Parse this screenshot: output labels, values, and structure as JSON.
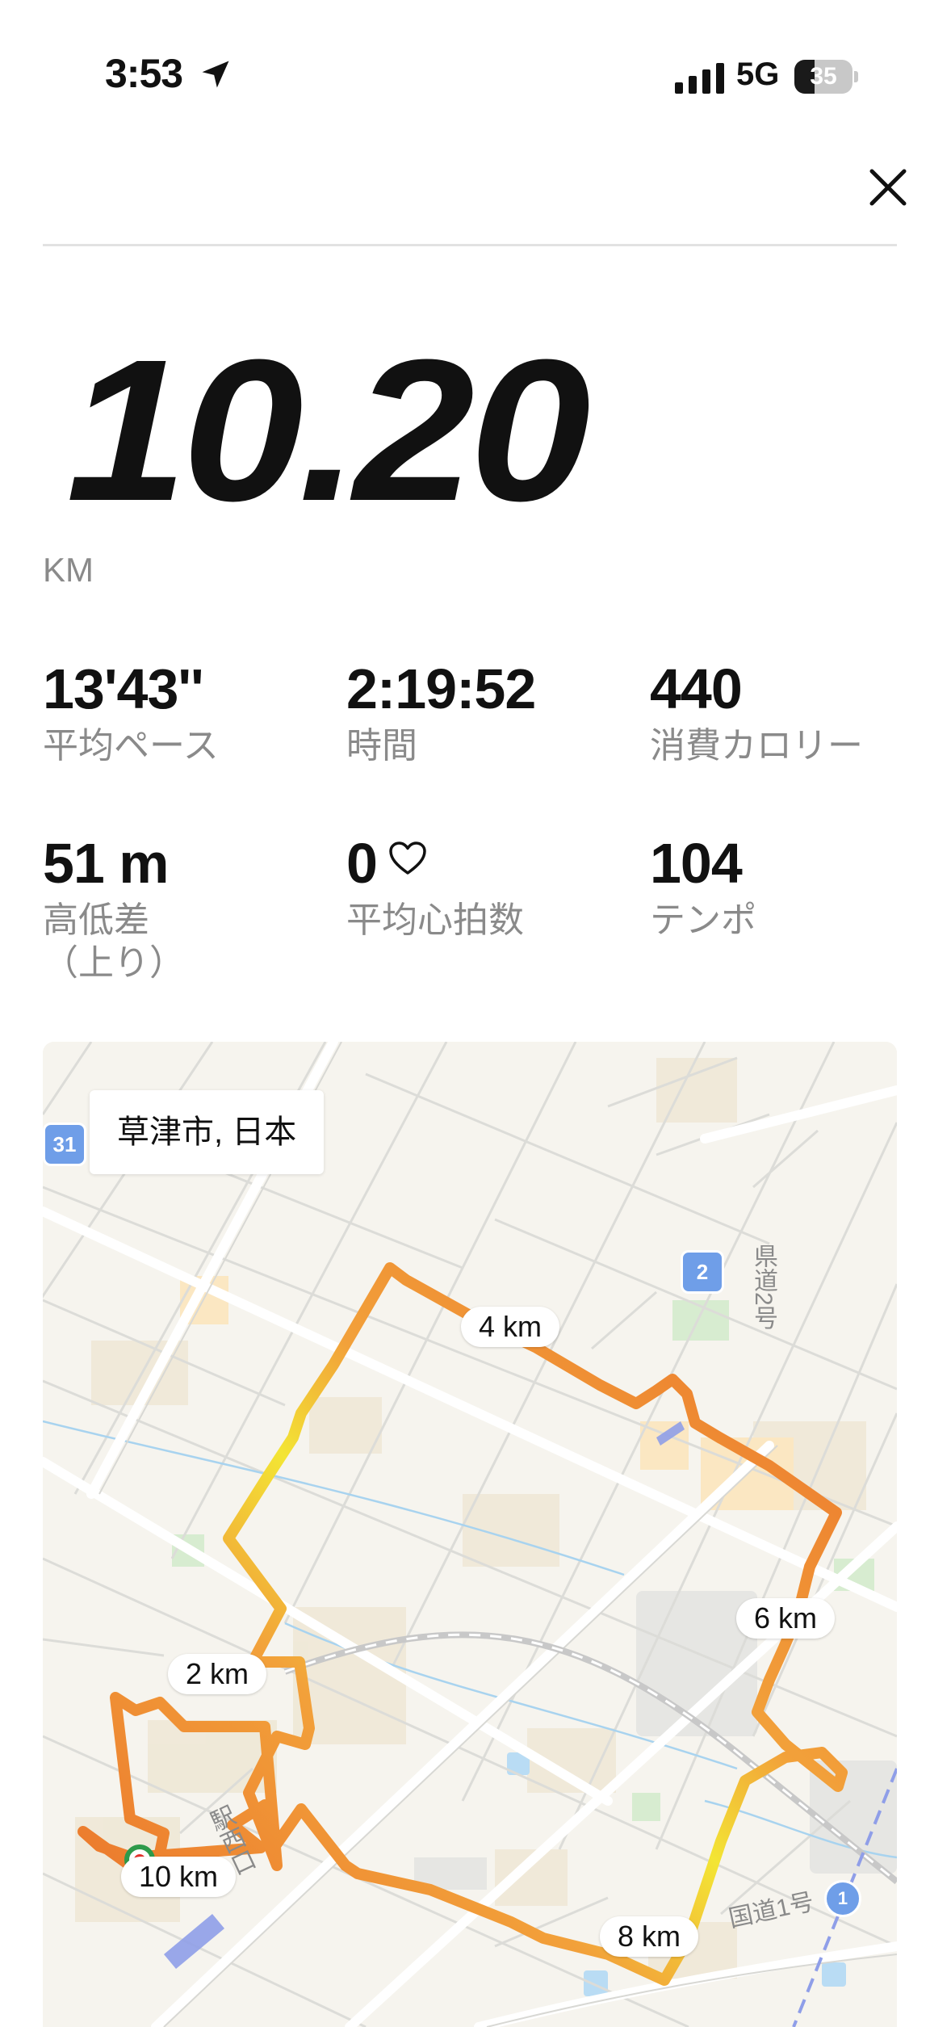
{
  "status_bar": {
    "time": "3:53",
    "network": "5G",
    "battery": 35
  },
  "run": {
    "distance": "10.20",
    "distance_unit": "KM"
  },
  "stats": [
    {
      "value": "13'43''",
      "label": "平均ペース"
    },
    {
      "value": "2:19:52",
      "label": "時間"
    },
    {
      "value": "440",
      "label": "消費カロリー"
    },
    {
      "value": "51 m",
      "label": "高低差\n（上り）"
    },
    {
      "value": "0",
      "label": "平均心拍数"
    },
    {
      "value": "104",
      "label": "テンポ"
    }
  ],
  "map": {
    "location": "草津市, 日本",
    "km_markers": [
      "2 km",
      "4 km",
      "6 km",
      "8 km",
      "10 km"
    ],
    "road_badges": [
      "31",
      "2",
      "1"
    ],
    "road_labels": [
      "県道2号",
      "国道1号",
      "駅西口"
    ]
  },
  "colors": {
    "route_start": "#f3e534",
    "route_mid": "#f2a13a",
    "route_end": "#ea6f2a",
    "label_gray": "#8a8a8a"
  }
}
